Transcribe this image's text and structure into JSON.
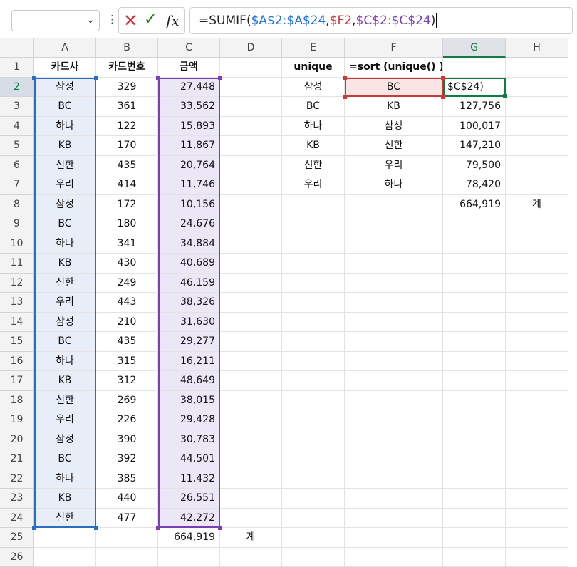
{
  "formula_bar": {
    "name_box": "",
    "formula_parts": [
      "=SUMIF(",
      "$A$2:$A$24",
      ",",
      "$F2",
      ",",
      "$C$2:$C$24",
      ")"
    ]
  },
  "columns": [
    "A",
    "B",
    "C",
    "D",
    "E",
    "F",
    "G",
    "H"
  ],
  "rows": [
    "1",
    "2",
    "3",
    "4",
    "5",
    "6",
    "7",
    "8",
    "9",
    "10",
    "11",
    "12",
    "13",
    "14",
    "15",
    "16",
    "17",
    "18",
    "19",
    "20",
    "21",
    "22",
    "23",
    "24",
    "25",
    "26"
  ],
  "table": {
    "headers": {
      "card": "카드사",
      "number": "카드번호",
      "amount": "금액"
    },
    "rows": [
      [
        "삼성",
        "329",
        "27,448"
      ],
      [
        "BC",
        "361",
        "33,562"
      ],
      [
        "하나",
        "122",
        "15,893"
      ],
      [
        "KB",
        "170",
        "11,867"
      ],
      [
        "신한",
        "435",
        "20,764"
      ],
      [
        "우리",
        "414",
        "11,746"
      ],
      [
        "삼성",
        "172",
        "10,156"
      ],
      [
        "BC",
        "180",
        "24,676"
      ],
      [
        "하나",
        "341",
        "34,884"
      ],
      [
        "KB",
        "430",
        "40,689"
      ],
      [
        "신한",
        "249",
        "46,159"
      ],
      [
        "우리",
        "443",
        "38,326"
      ],
      [
        "삼성",
        "210",
        "31,630"
      ],
      [
        "BC",
        "435",
        "29,277"
      ],
      [
        "하나",
        "315",
        "16,211"
      ],
      [
        "KB",
        "312",
        "48,649"
      ],
      [
        "신한",
        "269",
        "38,015"
      ],
      [
        "우리",
        "226",
        "29,428"
      ],
      [
        "삼성",
        "390",
        "30,783"
      ],
      [
        "BC",
        "392",
        "44,501"
      ],
      [
        "하나",
        "385",
        "11,432"
      ],
      [
        "KB",
        "440",
        "26,551"
      ],
      [
        "신한",
        "477",
        "42,272"
      ]
    ],
    "total_value": "664,919",
    "total_label": "계"
  },
  "summary": {
    "unique_header": "unique",
    "sort_header": "=sort (unique() )",
    "unique_values": [
      "삼성",
      "BC",
      "하나",
      "KB",
      "신한",
      "우리"
    ],
    "sorted_values": [
      "BC",
      "KB",
      "삼성",
      "신한",
      "우리",
      "하나"
    ],
    "editing_text": "$C$24)",
    "sums": [
      "127,756",
      "100,017",
      "147,210",
      "79,500",
      "78,420"
    ],
    "total_value": "664,919",
    "total_label": "계"
  }
}
